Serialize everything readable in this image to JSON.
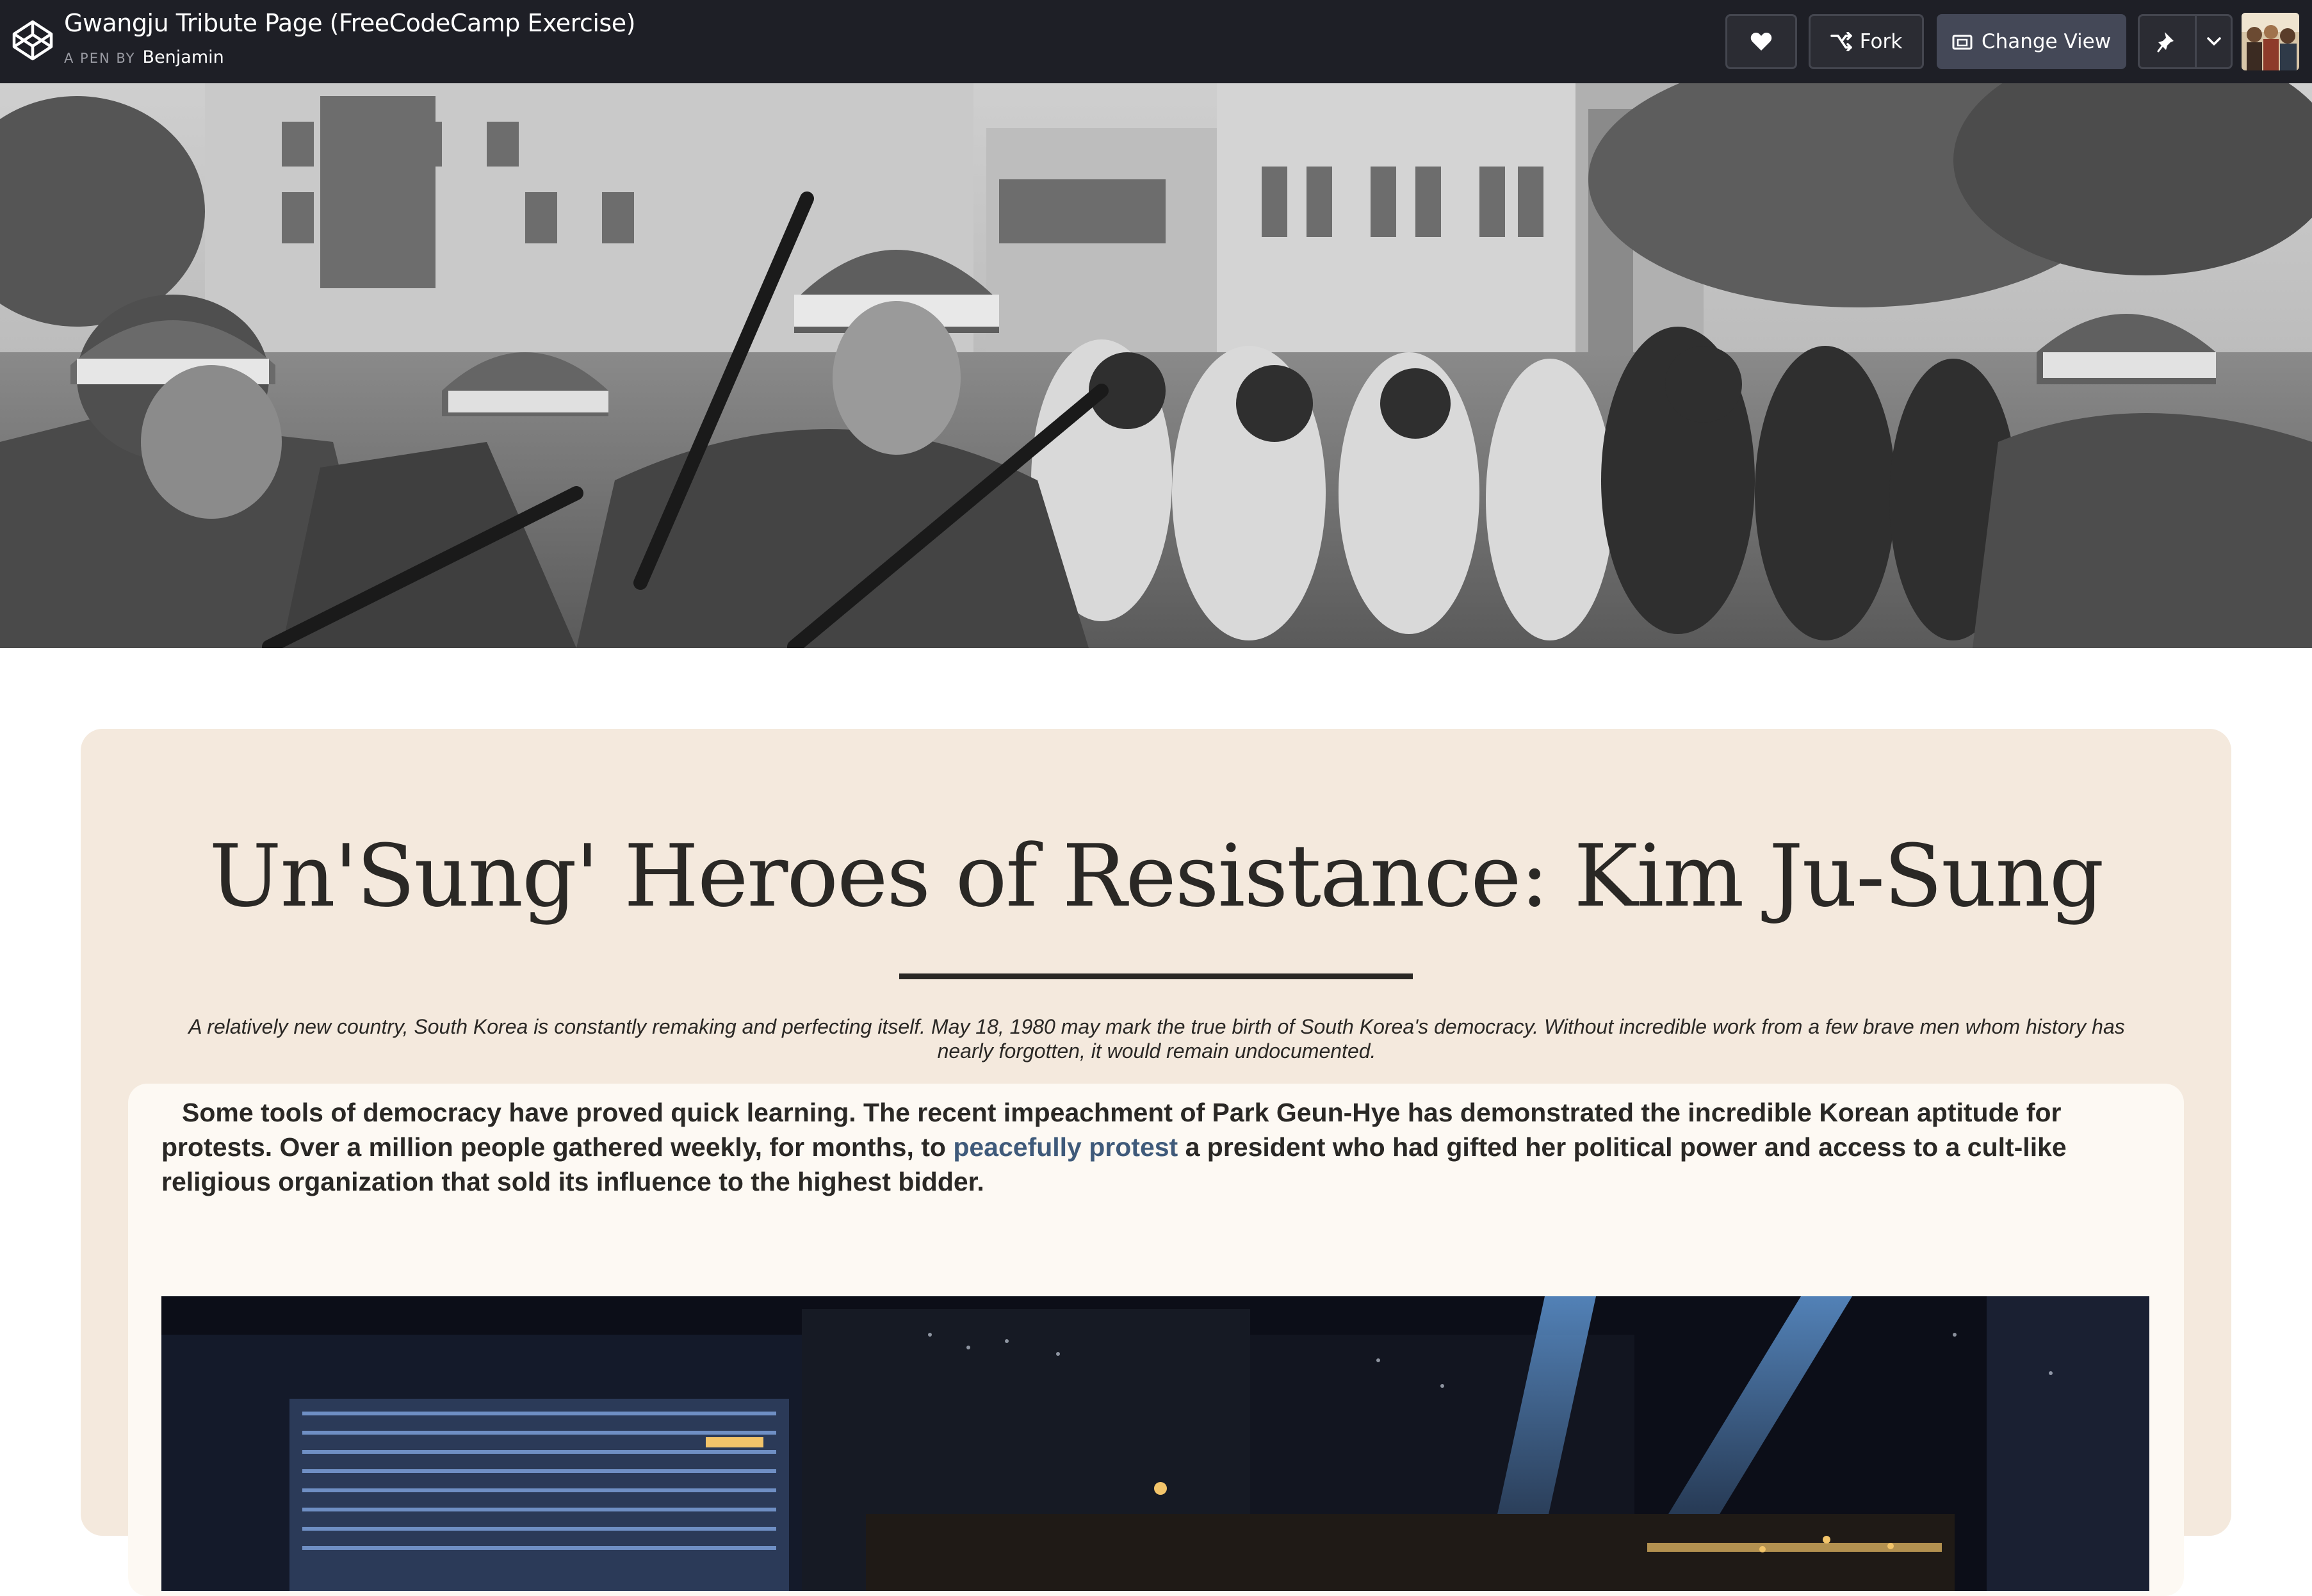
{
  "header": {
    "pen_title": "Gwangju Tribute Page (FreeCodeCamp Exercise)",
    "pen_by_label": "A PEN BY",
    "author": "Benjamin",
    "fork_label": "Fork",
    "change_view_label": "Change View"
  },
  "page": {
    "title": "Un'Sung' Heroes of Resistance: Kim Ju-Sung",
    "subtitle": "A relatively new country, South Korea is constantly remaking and perfecting itself. May 18, 1980 may mark the true birth of South Korea's democracy. Without incredible work from a few brave men whom history has nearly forgotten, it would remain undocumented.",
    "paragraph_before_link": "Some tools of democracy have proved quick learning. The recent impeachment of Park Geun-Hye has demonstrated the incredible Korean aptitude for protests. Over a million people gathered weekly, for months, to ",
    "paragraph_link": "peacefully protest",
    "paragraph_after_link": " a president who had gifted her political power and access to a cult-like religious organization that sold its influence to the highest bidder."
  },
  "icons": {
    "logo": "codepen-logo-icon",
    "heart": "heart-icon",
    "fork": "fork-icon",
    "view": "change-view-icon",
    "pin": "pin-icon",
    "chevron": "chevron-down-icon"
  },
  "colors": {
    "topbar_bg": "#1e1f26",
    "change_view_bg": "#444857",
    "card_bg": "#f4e9dd",
    "inner_panel_bg": "#fdf9f3",
    "text": "#2a2825",
    "link": "#3f5a7a"
  }
}
